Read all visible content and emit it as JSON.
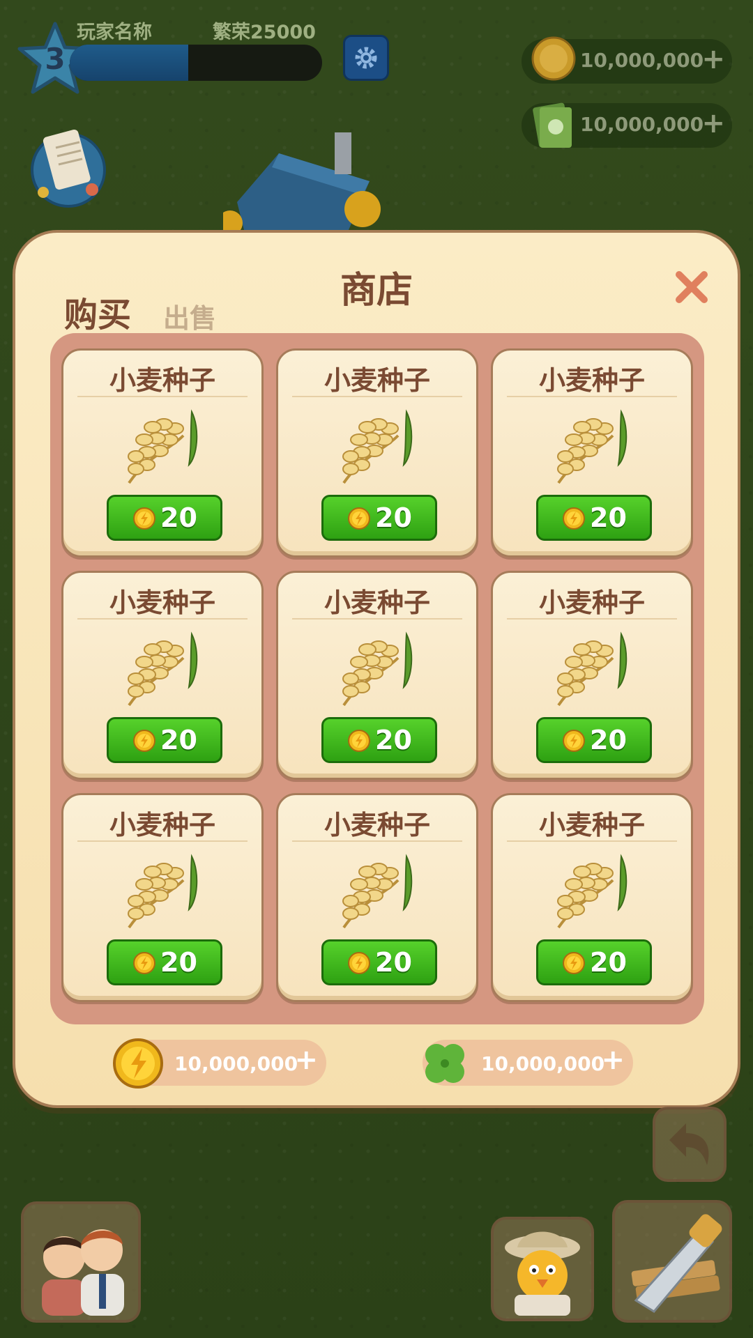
{
  "hud": {
    "level": "3",
    "player_name": "玩家名称",
    "prosperity": "繁荣25000",
    "xp_fraction": 0.47,
    "coins": "10,000,000",
    "cash": "10,000,000",
    "plus": "+"
  },
  "shop": {
    "title": "商店",
    "tab_buy": "购买",
    "tab_sell": "出售",
    "items": [
      {
        "name": "小麦种子",
        "price": "20"
      },
      {
        "name": "小麦种子",
        "price": "20"
      },
      {
        "name": "小麦种子",
        "price": "20"
      },
      {
        "name": "小麦种子",
        "price": "20"
      },
      {
        "name": "小麦种子",
        "price": "20"
      },
      {
        "name": "小麦种子",
        "price": "20"
      },
      {
        "name": "小麦种子",
        "price": "20"
      },
      {
        "name": "小麦种子",
        "price": "20"
      },
      {
        "name": "小麦种子",
        "price": "20"
      }
    ],
    "wallet_coins": "10,000,000",
    "wallet_clover": "10,000,000",
    "plus": "+"
  },
  "colors": {
    "panel": "#fbecc6",
    "grid_bg": "#d59781",
    "price_green": "#3fb81d",
    "title_brown": "#7a4a32"
  }
}
